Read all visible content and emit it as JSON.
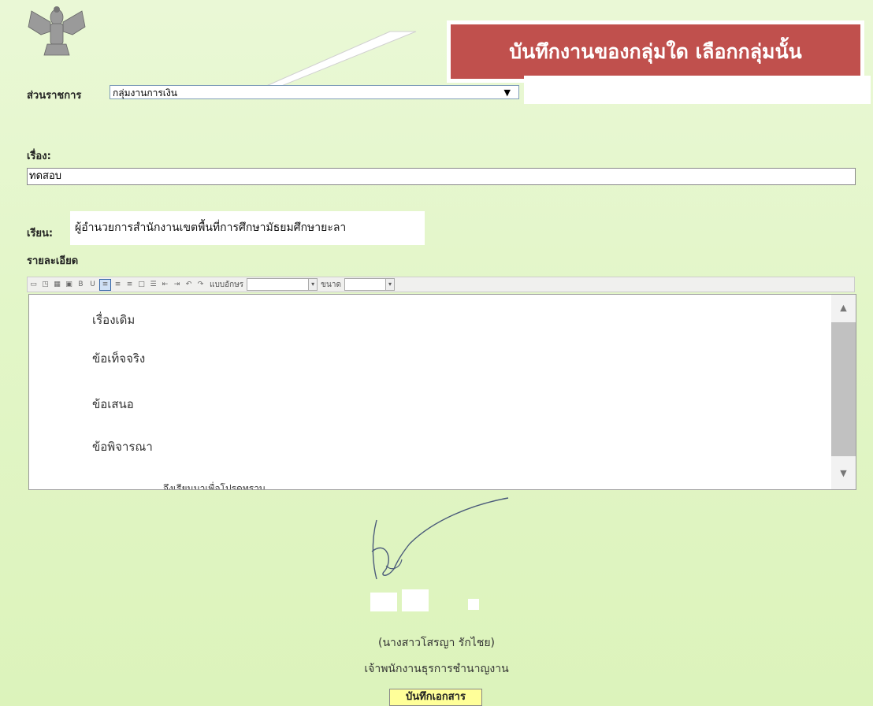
{
  "callout": {
    "text": "บันทึกงานของกลุ่มใด เลือกกลุ่มนั้น"
  },
  "department": {
    "label": "ส่วนราชการ",
    "selected": "กลุ่มงานการเงิน",
    "arrow": "▼"
  },
  "subject": {
    "label": "เรื่อง:",
    "value": "ทดสอบ"
  },
  "to": {
    "label": "เรียน:",
    "value": "ผู้อำนวยการสำนักงานเขตพื้นที่การศึกษามัธยมศึกษายะลา"
  },
  "details": {
    "label": "รายละเอียด"
  },
  "toolbar": {
    "icons": [
      "source-icon",
      "preview-icon",
      "table-icon",
      "image-icon",
      "bold-icon",
      "underline-icon",
      "align-left-icon",
      "align-center-icon",
      "align-right-icon",
      "justify-icon",
      "list-icon",
      "outdent-icon",
      "indent-icon",
      "undo-icon",
      "redo-icon"
    ],
    "font_label": "แบบอักษร",
    "size_label": "ขนาด"
  },
  "editor": {
    "lines": [
      "เรื่องเดิม",
      "ข้อเท็จจริง",
      "ข้อเสนอ",
      "ข้อพิจารณา",
      "จึงเรียนมาเพื่อโปรดทราบ"
    ]
  },
  "signature": {
    "name": "(นางสาวโสรญา รักไชย)",
    "position": "เจ้าพนักงานธุรการชำนาญงาน"
  },
  "save_button": {
    "label": "บันทึกเอกสาร"
  },
  "colors": {
    "callout": "#c0504d",
    "background": "#e3f6c9",
    "save_button": "#ffff99"
  }
}
